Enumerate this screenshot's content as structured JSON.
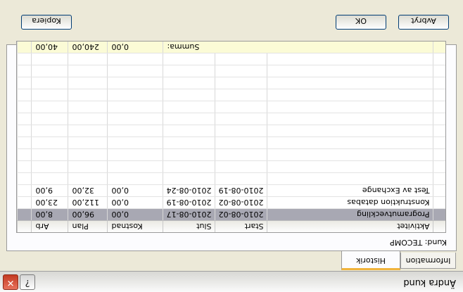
{
  "window": {
    "title": "Ändra kund"
  },
  "tabs": [
    {
      "label": "Information"
    },
    {
      "label": "Historik"
    }
  ],
  "customer": {
    "label": "Kund: TECOMP"
  },
  "table": {
    "columns": [
      "Aktivitet",
      "Start",
      "Slut",
      "Kostnad",
      "Plan",
      "Arb"
    ],
    "rows": [
      [
        "Programutveckling",
        "2010-08-02",
        "2010-08-17",
        "0,00",
        "96,00",
        "8,00"
      ],
      [
        "Konstruktion databas",
        "2010-08-02",
        "2010-08-19",
        "0,00",
        "112,00",
        "23,00"
      ],
      [
        "Test av Exchange",
        "2010-08-19",
        "2010-08-24",
        "0,00",
        "32,00",
        "9,00"
      ]
    ],
    "summary": {
      "label": "Summa:",
      "values": [
        "0,00",
        "240,00",
        "40,00"
      ]
    }
  },
  "buttons": {
    "copy": "Kopiera",
    "ok": "OK",
    "cancel": "Avbryt"
  }
}
